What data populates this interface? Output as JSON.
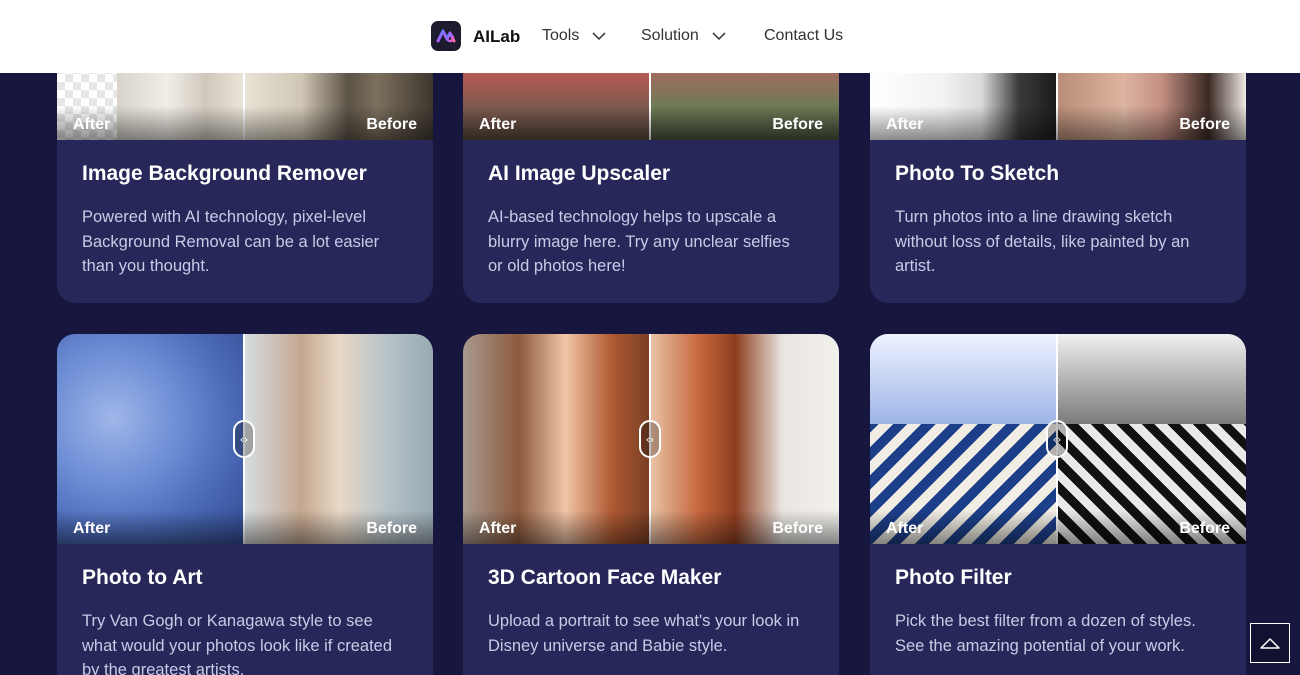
{
  "nav": {
    "brand": "AILab",
    "items": [
      {
        "label": "Tools"
      },
      {
        "label": "Solution"
      },
      {
        "label": "Contact Us"
      }
    ]
  },
  "compare": {
    "after": "After",
    "before": "Before"
  },
  "cards": [
    {
      "title": "Image Background Remover",
      "desc": "Powered with AI technology, pixel-level Background Removal can be a lot easier than you thought."
    },
    {
      "title": "AI Image Upscaler",
      "desc": "AI-based technology helps to upscale a blurry image here. Try any unclear selfies or old photos here!"
    },
    {
      "title": "Photo To Sketch",
      "desc": "Turn photos into a line drawing sketch without loss of details, like painted by an artist."
    },
    {
      "title": "Photo to Art",
      "desc": "Try Van Gogh or Kanagawa style to see what would your photos look like if created by the greatest artists."
    },
    {
      "title": "3D Cartoon Face Maker",
      "desc": "Upload a portrait to see what's your look in Disney universe and Babie style."
    },
    {
      "title": "Photo Filter",
      "desc": "Pick the best filter from a dozen of styles. See the amazing potential of your work."
    }
  ],
  "icons": {
    "logo": "ailab-logo-icon",
    "chevron": "chevron-down-icon",
    "handle": "compare-handle-icon",
    "to_top": "arrow-up-icon"
  },
  "colors": {
    "page_bg": "#16163f",
    "card_bg": "#272759",
    "title": "#ffffff",
    "desc": "#c9cbe6"
  }
}
